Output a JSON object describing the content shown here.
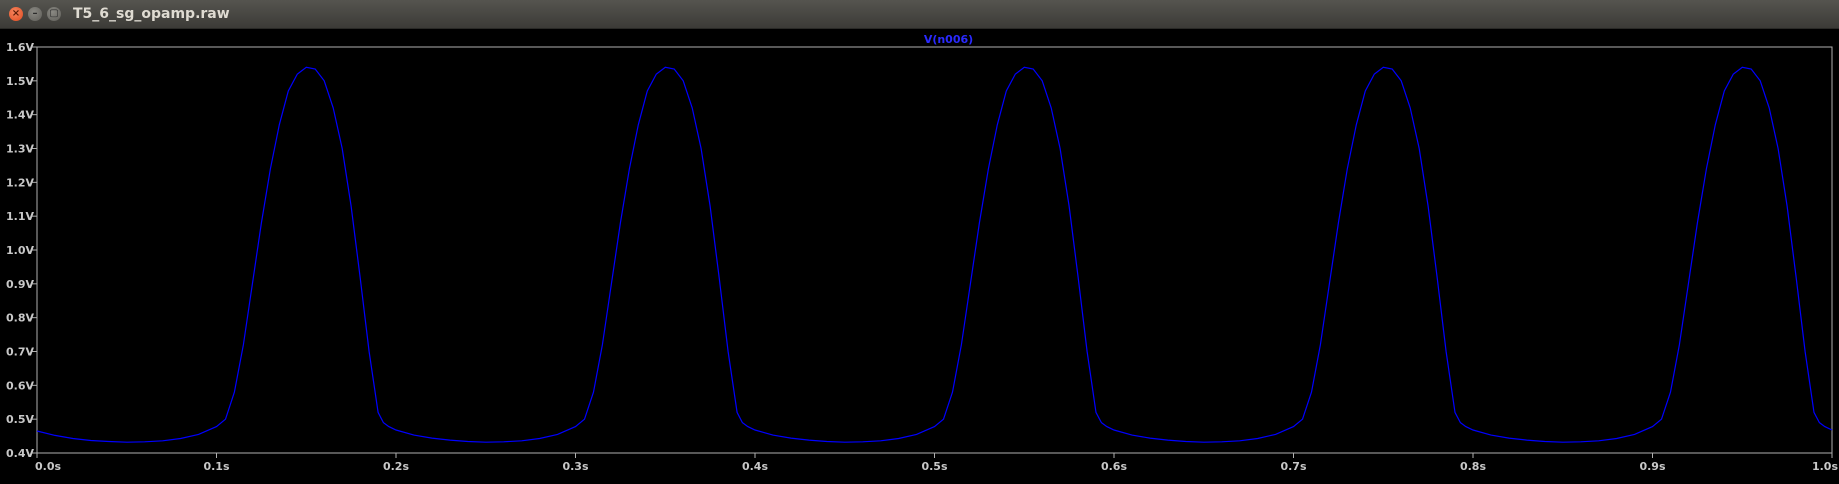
{
  "window": {
    "title": "T5_6_sg_opamp.raw",
    "close_glyph": "×",
    "min_glyph": "–",
    "max_glyph": "▢"
  },
  "colors": {
    "trace": "#0000ff",
    "axis": "#b0b0b0",
    "tick_text": "#c8c8c8",
    "trace_label": "#2a2aff"
  },
  "chart_data": {
    "type": "line",
    "title": "",
    "xlabel": "",
    "ylabel": "",
    "xlim": [
      0.0,
      1.0
    ],
    "ylim": [
      0.4,
      1.6
    ],
    "grid": false,
    "legend": "top-center",
    "x_ticks": [
      0.0,
      0.1,
      0.2,
      0.3,
      0.4,
      0.5,
      0.6,
      0.7,
      0.8,
      0.9,
      1.0
    ],
    "x_tick_labels": [
      "0.0s",
      "0.1s",
      "0.2s",
      "0.3s",
      "0.4s",
      "0.5s",
      "0.6s",
      "0.7s",
      "0.8s",
      "0.9s",
      "1.0s"
    ],
    "y_ticks": [
      0.4,
      0.5,
      0.6,
      0.7,
      0.8,
      0.9,
      1.0,
      1.1,
      1.2,
      1.3,
      1.4,
      1.5,
      1.6
    ],
    "y_tick_labels": [
      "0.4V",
      "0.5V",
      "0.6V",
      "0.7V",
      "0.8V",
      "0.9V",
      "1.0V",
      "1.1V",
      "1.2V",
      "1.3V",
      "1.4V",
      "1.5V",
      "1.6V"
    ],
    "series": [
      {
        "name": "V(n006)",
        "x": [
          0.0,
          0.01,
          0.02,
          0.03,
          0.04,
          0.05,
          0.06,
          0.07,
          0.08,
          0.09,
          0.1,
          0.105,
          0.11,
          0.115,
          0.12,
          0.125,
          0.13,
          0.135,
          0.14,
          0.145,
          0.15,
          0.155,
          0.16,
          0.165,
          0.17,
          0.175,
          0.18,
          0.185,
          0.19,
          0.193,
          0.196,
          0.2,
          0.21,
          0.22,
          0.23,
          0.24,
          0.25,
          0.26,
          0.27,
          0.28,
          0.29,
          0.3,
          0.305,
          0.31,
          0.315,
          0.32,
          0.325,
          0.33,
          0.335,
          0.34,
          0.345,
          0.35,
          0.355,
          0.36,
          0.365,
          0.37,
          0.375,
          0.38,
          0.385,
          0.39,
          0.393,
          0.396,
          0.4,
          0.41,
          0.42,
          0.43,
          0.44,
          0.45,
          0.46,
          0.47,
          0.48,
          0.49,
          0.5,
          0.505,
          0.51,
          0.515,
          0.52,
          0.525,
          0.53,
          0.535,
          0.54,
          0.545,
          0.55,
          0.555,
          0.56,
          0.565,
          0.57,
          0.575,
          0.58,
          0.585,
          0.59,
          0.593,
          0.596,
          0.6,
          0.61,
          0.62,
          0.63,
          0.64,
          0.65,
          0.66,
          0.67,
          0.68,
          0.69,
          0.7,
          0.705,
          0.71,
          0.715,
          0.72,
          0.725,
          0.73,
          0.735,
          0.74,
          0.745,
          0.75,
          0.755,
          0.76,
          0.765,
          0.77,
          0.775,
          0.78,
          0.785,
          0.79,
          0.793,
          0.796,
          0.8,
          0.81,
          0.82,
          0.83,
          0.84,
          0.85,
          0.86,
          0.87,
          0.88,
          0.89,
          0.9,
          0.905,
          0.91,
          0.915,
          0.92,
          0.925,
          0.93,
          0.935,
          0.94,
          0.945,
          0.95,
          0.955,
          0.96,
          0.965,
          0.97,
          0.975,
          0.98,
          0.985,
          0.99,
          0.993,
          0.996,
          1.0
        ],
        "y": [
          0.465,
          0.452,
          0.443,
          0.437,
          0.434,
          0.432,
          0.433,
          0.436,
          0.443,
          0.455,
          0.478,
          0.5,
          0.58,
          0.72,
          0.9,
          1.08,
          1.24,
          1.37,
          1.47,
          1.52,
          1.54,
          1.535,
          1.5,
          1.42,
          1.3,
          1.13,
          0.92,
          0.7,
          0.52,
          0.49,
          0.478,
          0.468,
          0.453,
          0.444,
          0.438,
          0.434,
          0.432,
          0.433,
          0.436,
          0.443,
          0.455,
          0.478,
          0.5,
          0.58,
          0.72,
          0.9,
          1.08,
          1.24,
          1.37,
          1.47,
          1.52,
          1.54,
          1.535,
          1.5,
          1.42,
          1.3,
          1.13,
          0.92,
          0.7,
          0.52,
          0.49,
          0.478,
          0.468,
          0.453,
          0.444,
          0.438,
          0.434,
          0.432,
          0.433,
          0.436,
          0.443,
          0.455,
          0.478,
          0.5,
          0.58,
          0.72,
          0.9,
          1.08,
          1.24,
          1.37,
          1.47,
          1.52,
          1.54,
          1.535,
          1.5,
          1.42,
          1.3,
          1.13,
          0.92,
          0.7,
          0.52,
          0.49,
          0.478,
          0.468,
          0.453,
          0.444,
          0.438,
          0.434,
          0.432,
          0.433,
          0.436,
          0.443,
          0.455,
          0.478,
          0.5,
          0.58,
          0.72,
          0.9,
          1.08,
          1.24,
          1.37,
          1.47,
          1.52,
          1.54,
          1.535,
          1.5,
          1.42,
          1.3,
          1.13,
          0.92,
          0.7,
          0.52,
          0.49,
          0.478,
          0.468,
          0.453,
          0.444,
          0.438,
          0.434,
          0.432,
          0.433,
          0.436,
          0.443,
          0.455,
          0.478,
          0.5,
          0.58,
          0.72,
          0.9,
          1.08,
          1.24,
          1.37,
          1.47,
          1.52,
          1.54,
          1.535,
          1.5,
          1.42,
          1.3,
          1.13,
          0.92,
          0.7,
          0.52,
          0.49,
          0.478,
          0.468
        ]
      }
    ]
  }
}
